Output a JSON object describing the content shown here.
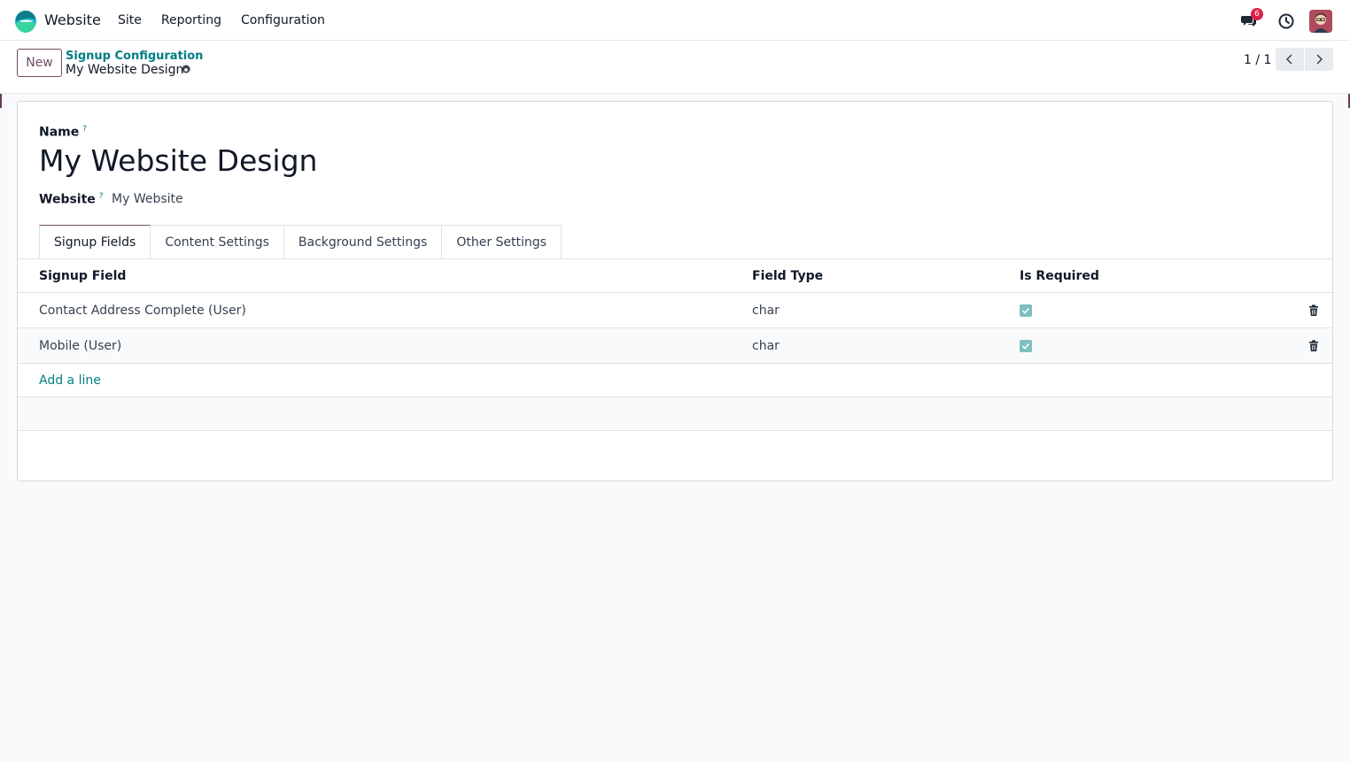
{
  "navbar": {
    "app_name": "Website",
    "menu": [
      "Site",
      "Reporting",
      "Configuration"
    ],
    "notification_count": "6",
    "icons": [
      "app-logo",
      "chat-icon",
      "clock-icon",
      "user-avatar"
    ]
  },
  "control_panel": {
    "new_label": "New",
    "breadcrumb_parent": "Signup Configuration",
    "breadcrumb_current": "My Website Design",
    "pager": "1 / 1"
  },
  "form": {
    "name_label": "Name",
    "help_mark": "?",
    "name_value": "My Website Design",
    "website_label": "Website",
    "website_value": "My Website",
    "tabs": [
      "Signup Fields",
      "Content Settings",
      "Background Settings",
      "Other Settings"
    ],
    "active_tab": "Signup Fields"
  },
  "table": {
    "columns": [
      "Signup Field",
      "Field Type",
      "Is Required"
    ],
    "rows": [
      {
        "field": "Contact Address Complete (User)",
        "type": "char",
        "required": true
      },
      {
        "field": "Mobile (User)",
        "type": "char",
        "required": true
      }
    ],
    "add_line_label": "Add a line"
  },
  "colors": {
    "brand": "#714b67",
    "link": "#017e84",
    "badge": "#e11d48",
    "checkbox": "#7fbfbf"
  }
}
